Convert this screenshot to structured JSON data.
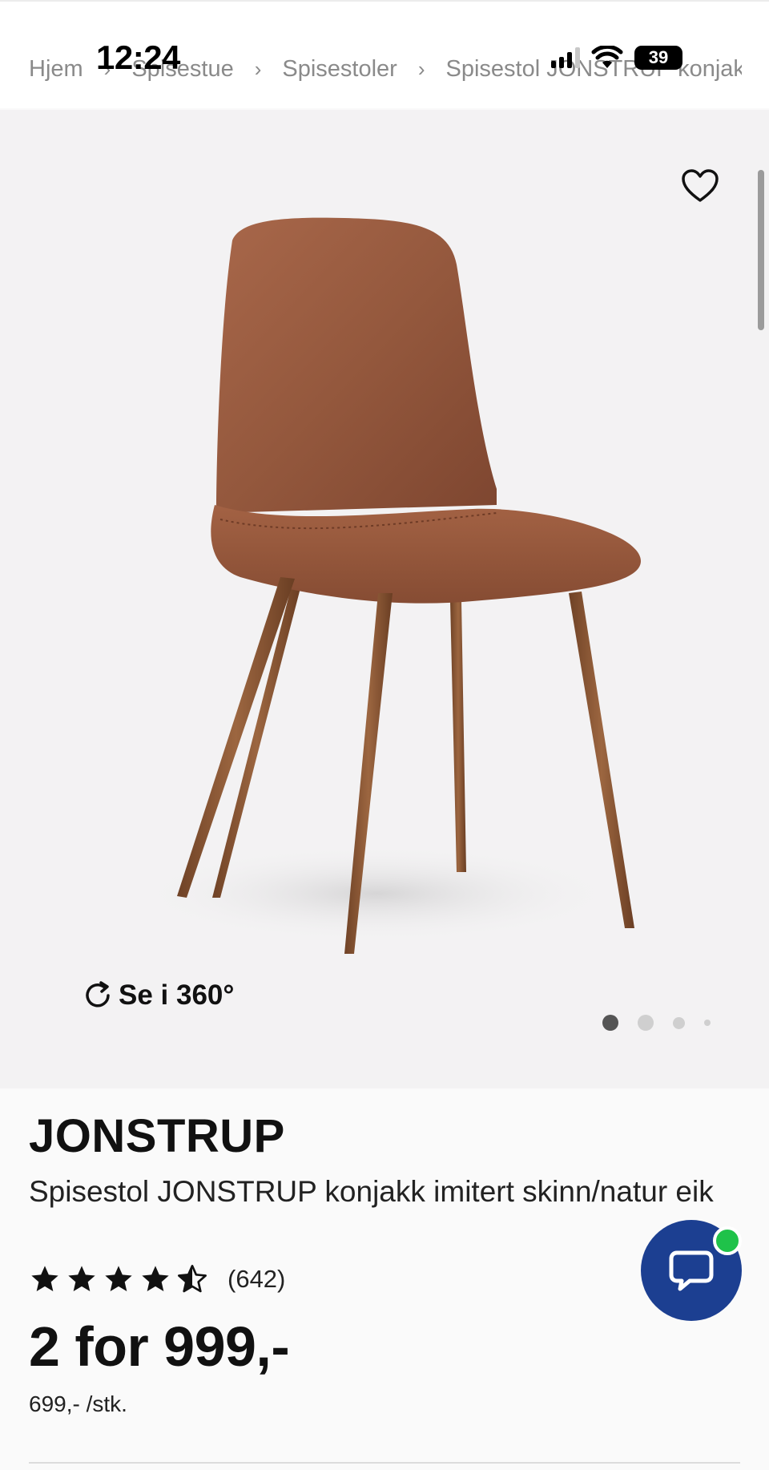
{
  "status_bar": {
    "time": "12:24",
    "battery": "39"
  },
  "breadcrumb": [
    "Hjem",
    "Spisestue",
    "Spisestoler",
    "Spisestol JONSTRUP konjakk"
  ],
  "gallery": {
    "view360_label": "Se i 360°",
    "slide_count": 4,
    "active_slide": 1
  },
  "product": {
    "brand": "JONSTRUP",
    "name": "Spisestol JONSTRUP konjakk imitert skinn/natur eik",
    "rating": 4.5,
    "rating_max": 5,
    "review_count": "(642)",
    "price": "2 for 999,-",
    "unit_price": "699,- /stk."
  },
  "icons": {
    "heart": "heart-outline-icon",
    "rotate": "rotate-360-icon",
    "chat": "chat-bubble-icon",
    "star": "star-icon"
  },
  "colors": {
    "chat_button": "#1c3f91",
    "online_badge": "#1fc24a",
    "chair_leather": "#9a5a3d",
    "chair_legs": "#8a5634"
  }
}
